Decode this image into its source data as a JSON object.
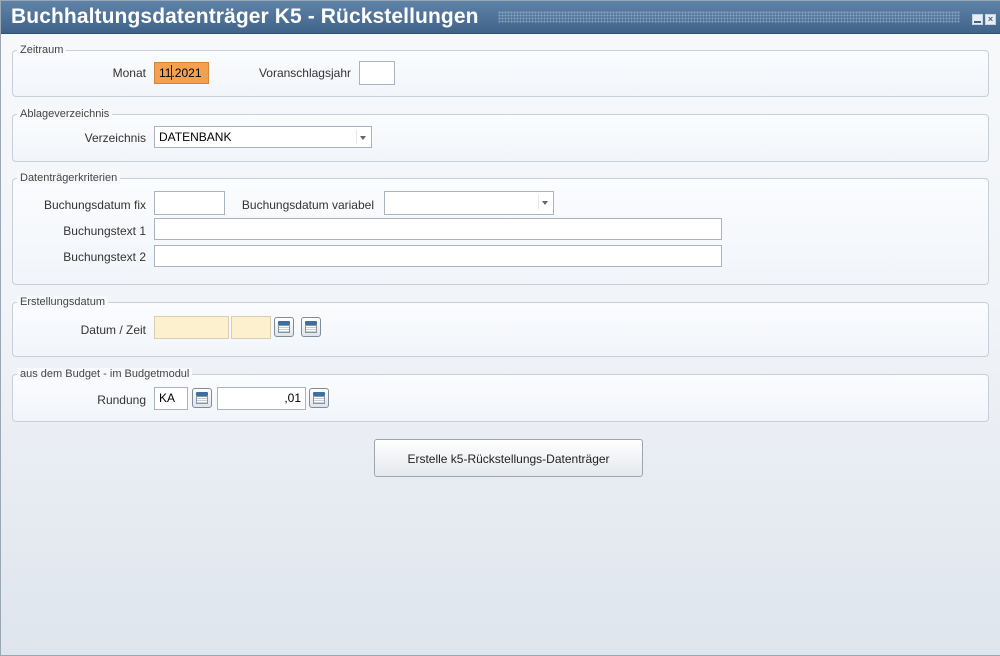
{
  "window": {
    "title": "Buchhaltungsdatenträger K5 - Rückstellungen",
    "close_glyph": "×"
  },
  "zeitraum": {
    "legend": "Zeitraum",
    "monat_label": "Monat",
    "monat_value": "11.2021",
    "voranschlagsjahr_label": "Voranschlagsjahr",
    "voranschlagsjahr_value": ""
  },
  "ablage": {
    "legend": "Ablageverzeichnis",
    "verzeichnis_label": "Verzeichnis",
    "verzeichnis_value": "DATENBANK"
  },
  "kriterien": {
    "legend": "Datenträgerkriterien",
    "buchungsdatum_fix_label": "Buchungsdatum fix",
    "buchungsdatum_fix_value": "",
    "buchungsdatum_variabel_label": "Buchungsdatum variabel",
    "buchungsdatum_variabel_value": "",
    "buchungstext1_label": "Buchungstext 1",
    "buchungstext1_value": "",
    "buchungstext2_label": "Buchungstext 2",
    "buchungstext2_value": ""
  },
  "erstellung": {
    "legend": "Erstellungsdatum",
    "datum_zeit_label": "Datum / Zeit",
    "datum_value": "",
    "zeit_value": ""
  },
  "budget": {
    "legend": "aus dem Budget - im Budgetmodul",
    "rundung_label": "Rundung",
    "rundung_code": "KA",
    "rundung_value": ",01"
  },
  "actions": {
    "create_label": "Erstelle k5-Rückstellungs-Datenträger"
  },
  "colors": {
    "titlebar": "#4a6f96",
    "highlight_field": "#f4a04f",
    "pale_field": "#fdf0cf"
  }
}
